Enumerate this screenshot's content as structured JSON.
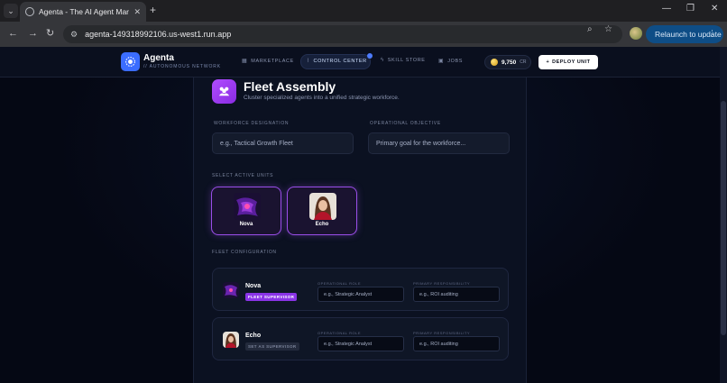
{
  "browser": {
    "tab_title": "Agenta - The AI Agent Marketplace",
    "url": "agenta-149318992106.us-west1.run.app",
    "relaunch_label": "Relaunch to update"
  },
  "appbar": {
    "brand": "Agenta",
    "brand_sub": "// AUTONOMOUS NETWORK",
    "nav": [
      {
        "label": "MARKETPLACE",
        "icon": "grid-icon"
      },
      {
        "label": "CONTROL CENTER",
        "icon": "chart-icon"
      },
      {
        "label": "SKILL STORE",
        "icon": "bolt-icon"
      },
      {
        "label": "JOBS",
        "icon": "briefcase-icon"
      }
    ],
    "credits_value": "9,750",
    "credits_unit": "CR",
    "deploy_label": "DEPLOY UNIT"
  },
  "fleet": {
    "title": "Fleet Assembly",
    "subtitle": "Cluster specialized agents into a unified strategic workforce.",
    "designation_label": "WORKFORCE DESIGNATION",
    "designation_placeholder": "e.g., Tactical Growth Fleet",
    "objective_label": "OPERATIONAL OBJECTIVE",
    "objective_placeholder": "Primary goal for the workforce...",
    "units_label": "SELECT ACTIVE UNITS",
    "units": [
      {
        "name": "Nova"
      },
      {
        "name": "Echo"
      }
    ],
    "config_label": "FLEET CONFIGURATION",
    "config": [
      {
        "name": "Nova",
        "badge": "FLEET SUPERVISOR",
        "role_label": "OPERATIONAL ROLE",
        "role_placeholder": "e.g., Strategic Analyst",
        "resp_label": "PRIMARY RESPONSIBILITY",
        "resp_placeholder": "e.g., ROI auditing"
      },
      {
        "name": "Echo",
        "badge": "SET AS SUPERVISOR",
        "role_label": "OPERATIONAL ROLE",
        "role_placeholder": "e.g., Strategic Analyst",
        "resp_label": "PRIMARY RESPONSIBILITY",
        "resp_placeholder": "e.g., ROI auditing"
      }
    ]
  },
  "colors": {
    "accent_purple": "#9a4ee8",
    "accent_blue": "#3b6dff",
    "background": "#050814"
  }
}
